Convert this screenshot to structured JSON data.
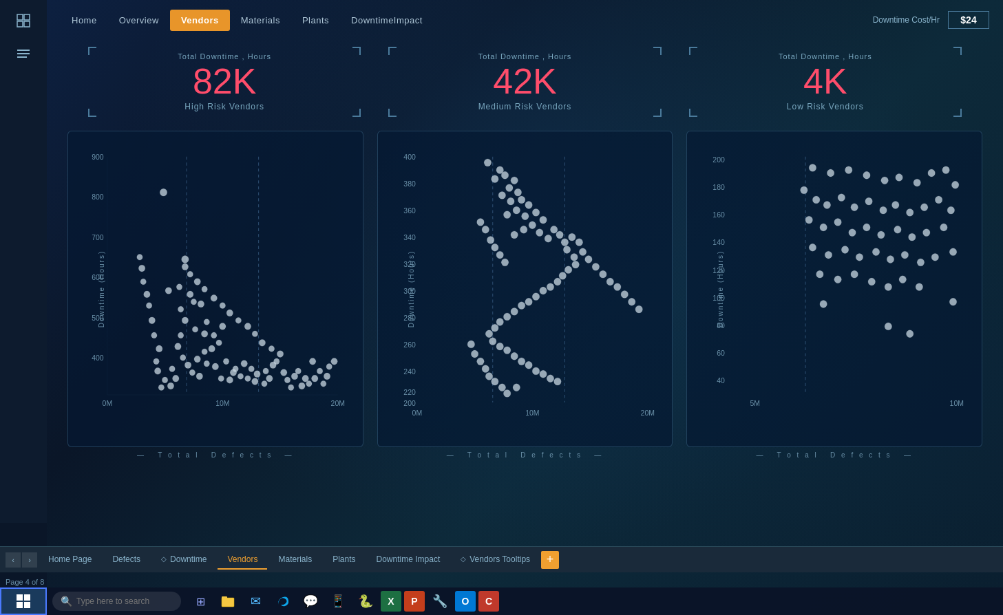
{
  "nav": {
    "items": [
      {
        "label": "Home",
        "active": false
      },
      {
        "label": "Overview",
        "active": false
      },
      {
        "label": "Vendors",
        "active": true
      },
      {
        "label": "Materials",
        "active": false
      },
      {
        "label": "Plants",
        "active": false
      },
      {
        "label": "DowntimeImpact",
        "active": false
      }
    ],
    "downtime_cost_label": "Downtime Cost/Hr",
    "downtime_cost_value": "$24"
  },
  "kpis": [
    {
      "label": "Total Downtime , Hours",
      "value": "82K",
      "sublabel": "High Risk Vendors"
    },
    {
      "label": "Total Downtime , Hours",
      "value": "42K",
      "sublabel": "Medium Risk Vendors"
    },
    {
      "label": "Total Downtime , Hours",
      "value": "4K",
      "sublabel": "Low Risk Vendors"
    }
  ],
  "charts": [
    {
      "id": "high-risk",
      "title": "Total Defects",
      "y_axis_label": "Downtime (Hours)",
      "x_min": "0M",
      "x_mid": "10M",
      "x_max": "20M",
      "y_min": "400",
      "y_max": "900"
    },
    {
      "id": "medium-risk",
      "title": "Total Defects",
      "y_axis_label": "Downtime (Hours)",
      "x_min": "0M",
      "x_mid": "10M",
      "x_max": "20M",
      "y_min": "200",
      "y_max": "400"
    },
    {
      "id": "low-risk",
      "title": "Total Defects",
      "y_axis_label": "Downtime (Hours)",
      "x_min": "5M",
      "x_mid": "",
      "x_max": "10M",
      "y_min": "40",
      "y_max": "200"
    }
  ],
  "tabs": {
    "prev": "‹",
    "next": "›",
    "items": [
      {
        "label": "Home Page",
        "active": false,
        "icon": ""
      },
      {
        "label": "Defects",
        "active": false,
        "icon": ""
      },
      {
        "label": "Downtime",
        "active": false,
        "icon": "◇"
      },
      {
        "label": "Vendors",
        "active": true,
        "icon": ""
      },
      {
        "label": "Materials",
        "active": false,
        "icon": ""
      },
      {
        "label": "Plants",
        "active": false,
        "icon": ""
      },
      {
        "label": "Downtime Impact",
        "active": false,
        "icon": ""
      },
      {
        "label": "Vendors Tooltips",
        "active": false,
        "icon": "◇"
      },
      {
        "label": "+",
        "active": false,
        "icon": ""
      }
    ],
    "page_indicator": "Page 4 of 8"
  },
  "taskbar": {
    "search_placeholder": "Type here to search",
    "apps": [
      "🪟",
      "🔍",
      "⊞",
      "📁",
      "✉",
      "🌐",
      "💬",
      "📱",
      "🐍",
      "🅴",
      "📊",
      "🎮",
      "📘",
      "🟦",
      "🔷"
    ]
  },
  "sidebar": {
    "icons": [
      "⊞",
      "☰"
    ]
  }
}
